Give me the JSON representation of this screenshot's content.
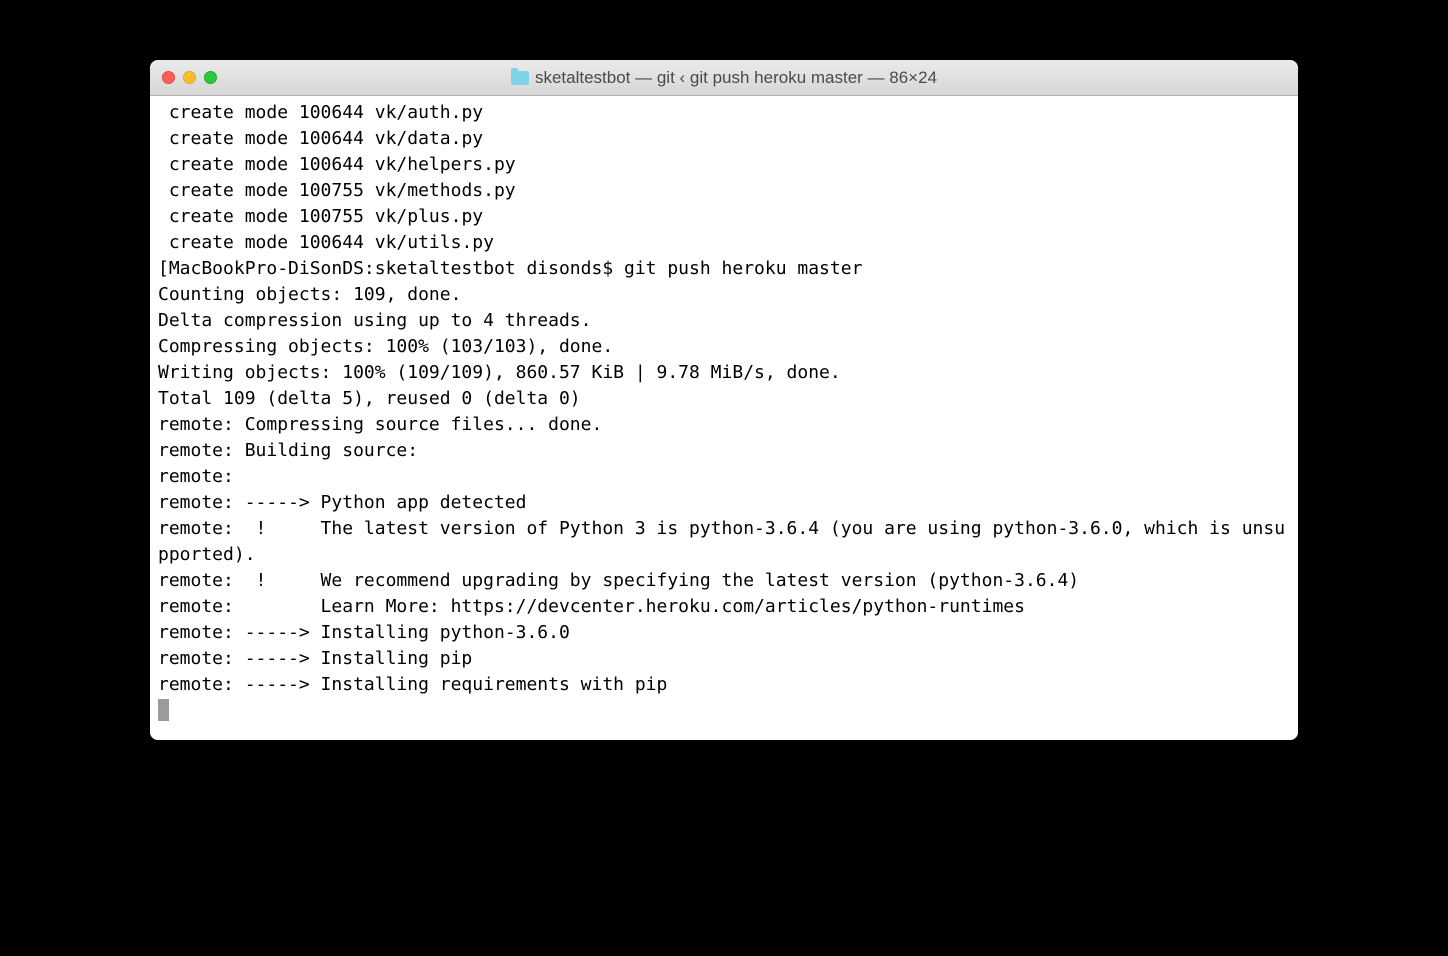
{
  "window": {
    "title": "sketaltestbot — git ‹ git push heroku master — 86×24",
    "folder_icon": "folder-icon"
  },
  "terminal": {
    "lines": [
      " create mode 100644 vk/auth.py",
      " create mode 100644 vk/data.py",
      " create mode 100644 vk/helpers.py",
      " create mode 100755 vk/methods.py",
      " create mode 100755 vk/plus.py",
      " create mode 100644 vk/utils.py",
      "[MacBookPro-DiSonDS:sketaltestbot disonds$ git push heroku master",
      "Counting objects: 109, done.",
      "Delta compression using up to 4 threads.",
      "Compressing objects: 100% (103/103), done.",
      "Writing objects: 100% (109/109), 860.57 KiB | 9.78 MiB/s, done.",
      "Total 109 (delta 5), reused 0 (delta 0)",
      "remote: Compressing source files... done.",
      "remote: Building source:",
      "remote:",
      "remote: -----> Python app detected",
      "remote:  !     The latest version of Python 3 is python-3.6.4 (you are using python-3.6.0, which is unsupported).",
      "remote:  !     We recommend upgrading by specifying the latest version (python-3.6.4)",
      "remote:        Learn More: https://devcenter.heroku.com/articles/python-runtimes",
      "remote: -----> Installing python-3.6.0",
      "remote: -----> Installing pip",
      "remote: -----> Installing requirements with pip"
    ]
  }
}
